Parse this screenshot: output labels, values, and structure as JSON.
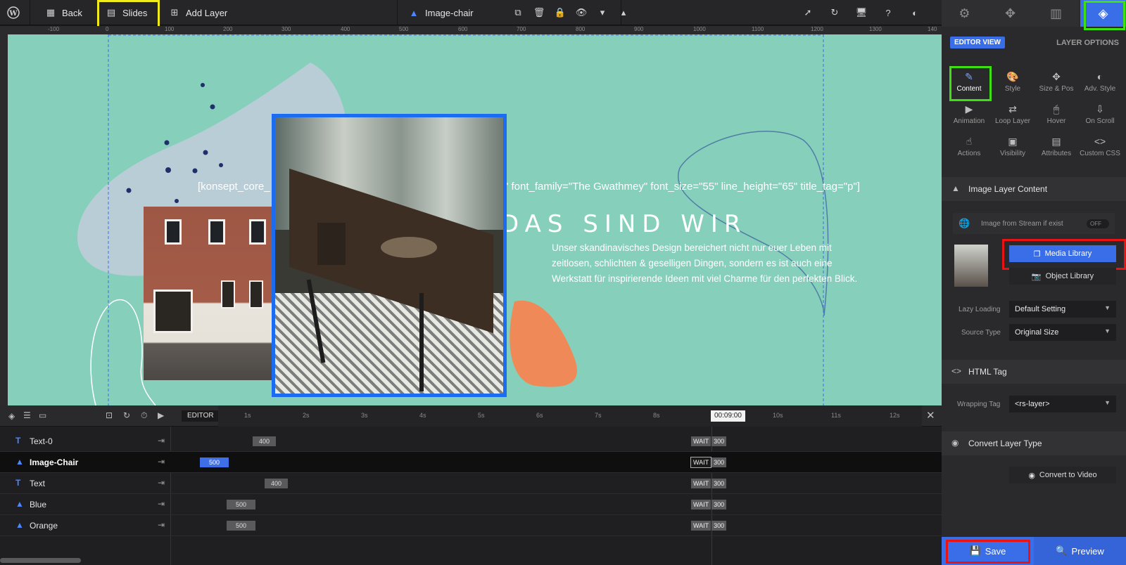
{
  "toolbar": {
    "back_label": "Back",
    "slides_label": "Slides",
    "add_layer_label": "Add Layer",
    "layer_name": "Image-chair"
  },
  "ruler": {
    "ticks": [
      "-100",
      "0",
      "100",
      "200",
      "300",
      "400",
      "500",
      "600",
      "700",
      "800",
      "900",
      "1000",
      "1100",
      "1200",
      "1300",
      "140"
    ]
  },
  "canvas": {
    "shortcode_text": "[konsept_core_",
    "shortcode_text_right": "\" font_family=\"The Gwathmey\" font_size=\"55\" line_height=\"65\" title_tag=\"p\"]",
    "heading": "DAS SIND WIR",
    "paragraph": "Unser skandinavisches Design bereichert nicht nur euer Leben mit zeitlosen, schlichten & geselligen Dingen, sondern es ist auch eine Werkstatt für inspirierende Ideen mit viel Charme für den perfekten Blick."
  },
  "timeline": {
    "editor_label": "EDITOR",
    "time_marks": [
      "1s",
      "2s",
      "3s",
      "4s",
      "5s",
      "6s",
      "7s",
      "8s",
      "9s",
      "10s",
      "11s",
      "12s"
    ],
    "current_time": "00:09:00",
    "wait_label": "WAIT",
    "layers": [
      {
        "name": "Text-0",
        "type": "T",
        "bar": "400"
      },
      {
        "name": "Image-Chair",
        "type": "img",
        "bar": "500"
      },
      {
        "name": "Text",
        "type": "T",
        "bar": "400"
      },
      {
        "name": "Blue",
        "type": "img",
        "bar": "500"
      },
      {
        "name": "Orange",
        "type": "img",
        "bar": "500"
      }
    ],
    "end_value": "300"
  },
  "panel": {
    "editor_view_label": "EDITOR VIEW",
    "layer_options_label": "LAYER OPTIONS",
    "options": [
      {
        "label": "Content"
      },
      {
        "label": "Style"
      },
      {
        "label": "Size & Pos"
      },
      {
        "label": "Adv. Style"
      },
      {
        "label": "Animation"
      },
      {
        "label": "Loop Layer"
      },
      {
        "label": "Hover"
      },
      {
        "label": "On Scroll"
      },
      {
        "label": "Actions"
      },
      {
        "label": "Visibility"
      },
      {
        "label": "Attributes"
      },
      {
        "label": "Custom CSS"
      }
    ],
    "image_section_title": "Image Layer Content",
    "stream_label": "Image from Stream if exist",
    "stream_toggle": "OFF",
    "media_library_label": "Media Library",
    "object_library_label": "Object Library",
    "lazy_loading_label": "Lazy Loading",
    "lazy_loading_value": "Default Setting",
    "source_type_label": "Source Type",
    "source_type_value": "Original Size",
    "html_tag_title": "HTML Tag",
    "wrapping_tag_label": "Wrapping Tag",
    "wrapping_tag_value": "<rs-layer>",
    "convert_title": "Convert Layer Type",
    "convert_video_label": "Convert to Video",
    "save_label": "Save",
    "preview_label": "Preview"
  },
  "colors": {
    "accent": "#3a6ee8",
    "canvas_bg": "#86cfba",
    "highlight_yellow": "#f1ea1d",
    "highlight_green": "#3ee014",
    "highlight_red": "#ea1313"
  }
}
